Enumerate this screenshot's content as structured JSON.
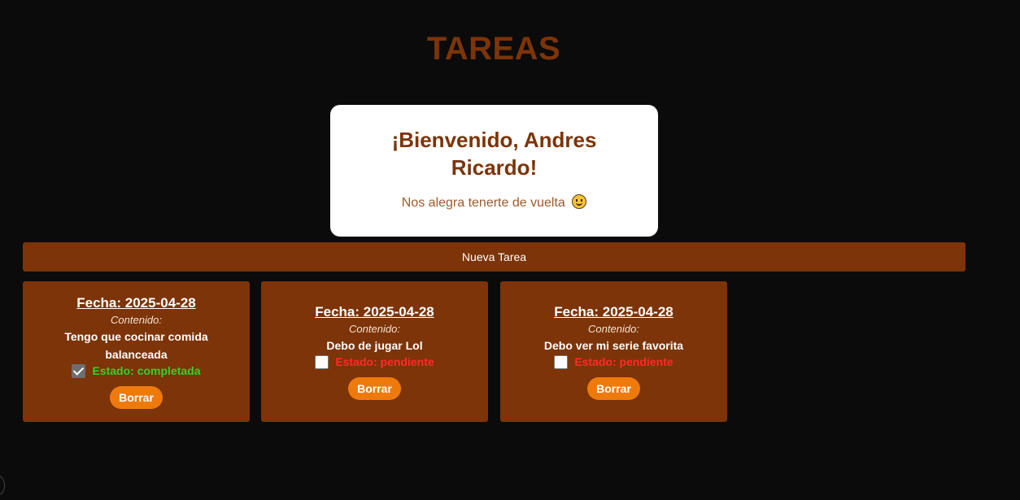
{
  "header": {
    "title": "TAREAS"
  },
  "welcome": {
    "heading": "¡Bienvenido, Andres Ricardo!",
    "message": "Nos alegra tenerte de vuelta",
    "emoji_icon": "smiling-face-icon"
  },
  "new_task": {
    "label": "Nueva Tarea"
  },
  "colors": {
    "background": "#0b0b0b",
    "primary": "#7c3408",
    "button": "#ef7a0c",
    "completed": "#2bd62b",
    "pending": "#ff2a2a"
  },
  "tasks": [
    {
      "date": "Fecha: 2025-04-28",
      "content_label": "Contenido:",
      "content": "Tengo que cocinar comida balanceada",
      "completed": true,
      "status": "Estado: completada",
      "delete_label": "Borrar"
    },
    {
      "date": "Fecha: 2025-04-28",
      "content_label": "Contenido:",
      "content": "Debo de jugar Lol",
      "completed": false,
      "status": "Estado: pendiente",
      "delete_label": "Borrar"
    },
    {
      "date": "Fecha: 2025-04-28",
      "content_label": "Contenido:",
      "content": "Debo ver mi serie favorita",
      "completed": false,
      "status": "Estado: pendiente",
      "delete_label": "Borrar"
    }
  ]
}
